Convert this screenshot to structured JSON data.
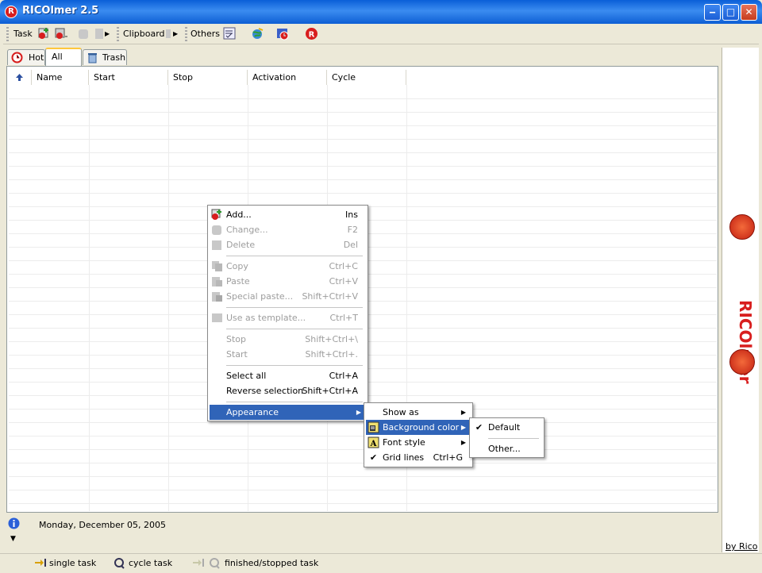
{
  "window": {
    "title": "RICOlmer 2.5",
    "app_icon": "R"
  },
  "toolbar": {
    "task_label": "Task",
    "clipboard_label": "Clipboard",
    "others_label": "Others"
  },
  "tabs": [
    {
      "label": "Hot"
    },
    {
      "label": "All"
    },
    {
      "label": "Trash"
    }
  ],
  "columns": [
    "Name",
    "Start",
    "Stop",
    "Activation",
    "Cycle"
  ],
  "context_menu": {
    "items": [
      {
        "label": "Add...",
        "shortcut": "Ins"
      },
      {
        "label": "Change...",
        "shortcut": "F2"
      },
      {
        "label": "Delete",
        "shortcut": "Del"
      },
      {
        "label": "Copy",
        "shortcut": "Ctrl+C"
      },
      {
        "label": "Paste",
        "shortcut": "Ctrl+V"
      },
      {
        "label": "Special paste...",
        "shortcut": "Shift+Ctrl+V"
      },
      {
        "label": "Use as template...",
        "shortcut": "Ctrl+T"
      },
      {
        "label": "Stop",
        "shortcut": "Shift+Ctrl+\\"
      },
      {
        "label": "Start",
        "shortcut": "Shift+Ctrl+."
      },
      {
        "label": "Select all",
        "shortcut": "Ctrl+A"
      },
      {
        "label": "Reverse selection",
        "shortcut": "Shift+Ctrl+A"
      },
      {
        "label": "Appearance",
        "shortcut": ""
      }
    ]
  },
  "appearance_menu": {
    "items": [
      {
        "label": "Show as",
        "shortcut": ""
      },
      {
        "label": "Background color",
        "shortcut": ""
      },
      {
        "label": "Font style",
        "shortcut": ""
      },
      {
        "label": "Grid lines",
        "shortcut": "Ctrl+G"
      }
    ]
  },
  "background_menu": {
    "items": [
      {
        "label": "Default"
      },
      {
        "label": "Other..."
      }
    ]
  },
  "side_panel": {
    "title": "RICOlmer",
    "credit": "by Rico"
  },
  "info": {
    "date": "Monday, December 05, 2005"
  },
  "status": {
    "single": "single task",
    "cycle": "cycle task",
    "finished": "finished/stopped task"
  },
  "colors": {
    "accent": "#3064b8",
    "brand_red": "#d81e1e",
    "titlebar": "#0a5fd8"
  }
}
